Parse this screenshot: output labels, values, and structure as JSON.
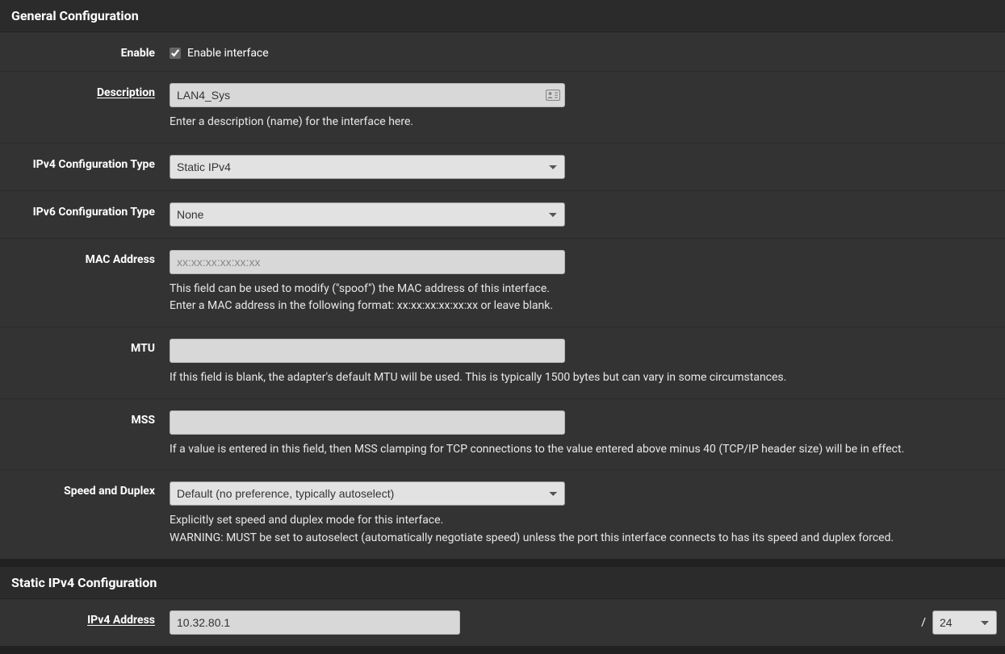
{
  "general": {
    "title": "General Configuration",
    "enable": {
      "label": "Enable",
      "checkbox_label": "Enable interface",
      "checked": true
    },
    "description": {
      "label": "Description",
      "value": "LAN4_Sys",
      "help": "Enter a description (name) for the interface here."
    },
    "ipv4_type": {
      "label": "IPv4 Configuration Type",
      "value": "Static IPv4"
    },
    "ipv6_type": {
      "label": "IPv6 Configuration Type",
      "value": "None"
    },
    "mac": {
      "label": "MAC Address",
      "placeholder": "xx:xx:xx:xx:xx:xx",
      "value": "",
      "help1": "This field can be used to modify (\"spoof\") the MAC address of this interface.",
      "help2": "Enter a MAC address in the following format: xx:xx:xx:xx:xx:xx or leave blank."
    },
    "mtu": {
      "label": "MTU",
      "value": "",
      "help": "If this field is blank, the adapter's default MTU will be used. This is typically 1500 bytes but can vary in some circumstances."
    },
    "mss": {
      "label": "MSS",
      "value": "",
      "help": "If a value is entered in this field, then MSS clamping for TCP connections to the value entered above minus 40 (TCP/IP header size) will be in effect."
    },
    "speed": {
      "label": "Speed and Duplex",
      "value": "Default (no preference, typically autoselect)",
      "help1": "Explicitly set speed and duplex mode for this interface.",
      "help2": "WARNING: MUST be set to autoselect (automatically negotiate speed) unless the port this interface connects to has its speed and duplex forced."
    }
  },
  "static_ipv4": {
    "title": "Static IPv4 Configuration",
    "address": {
      "label": "IPv4 Address",
      "value": "10.32.80.1",
      "slash": "/",
      "prefix": "24"
    }
  }
}
